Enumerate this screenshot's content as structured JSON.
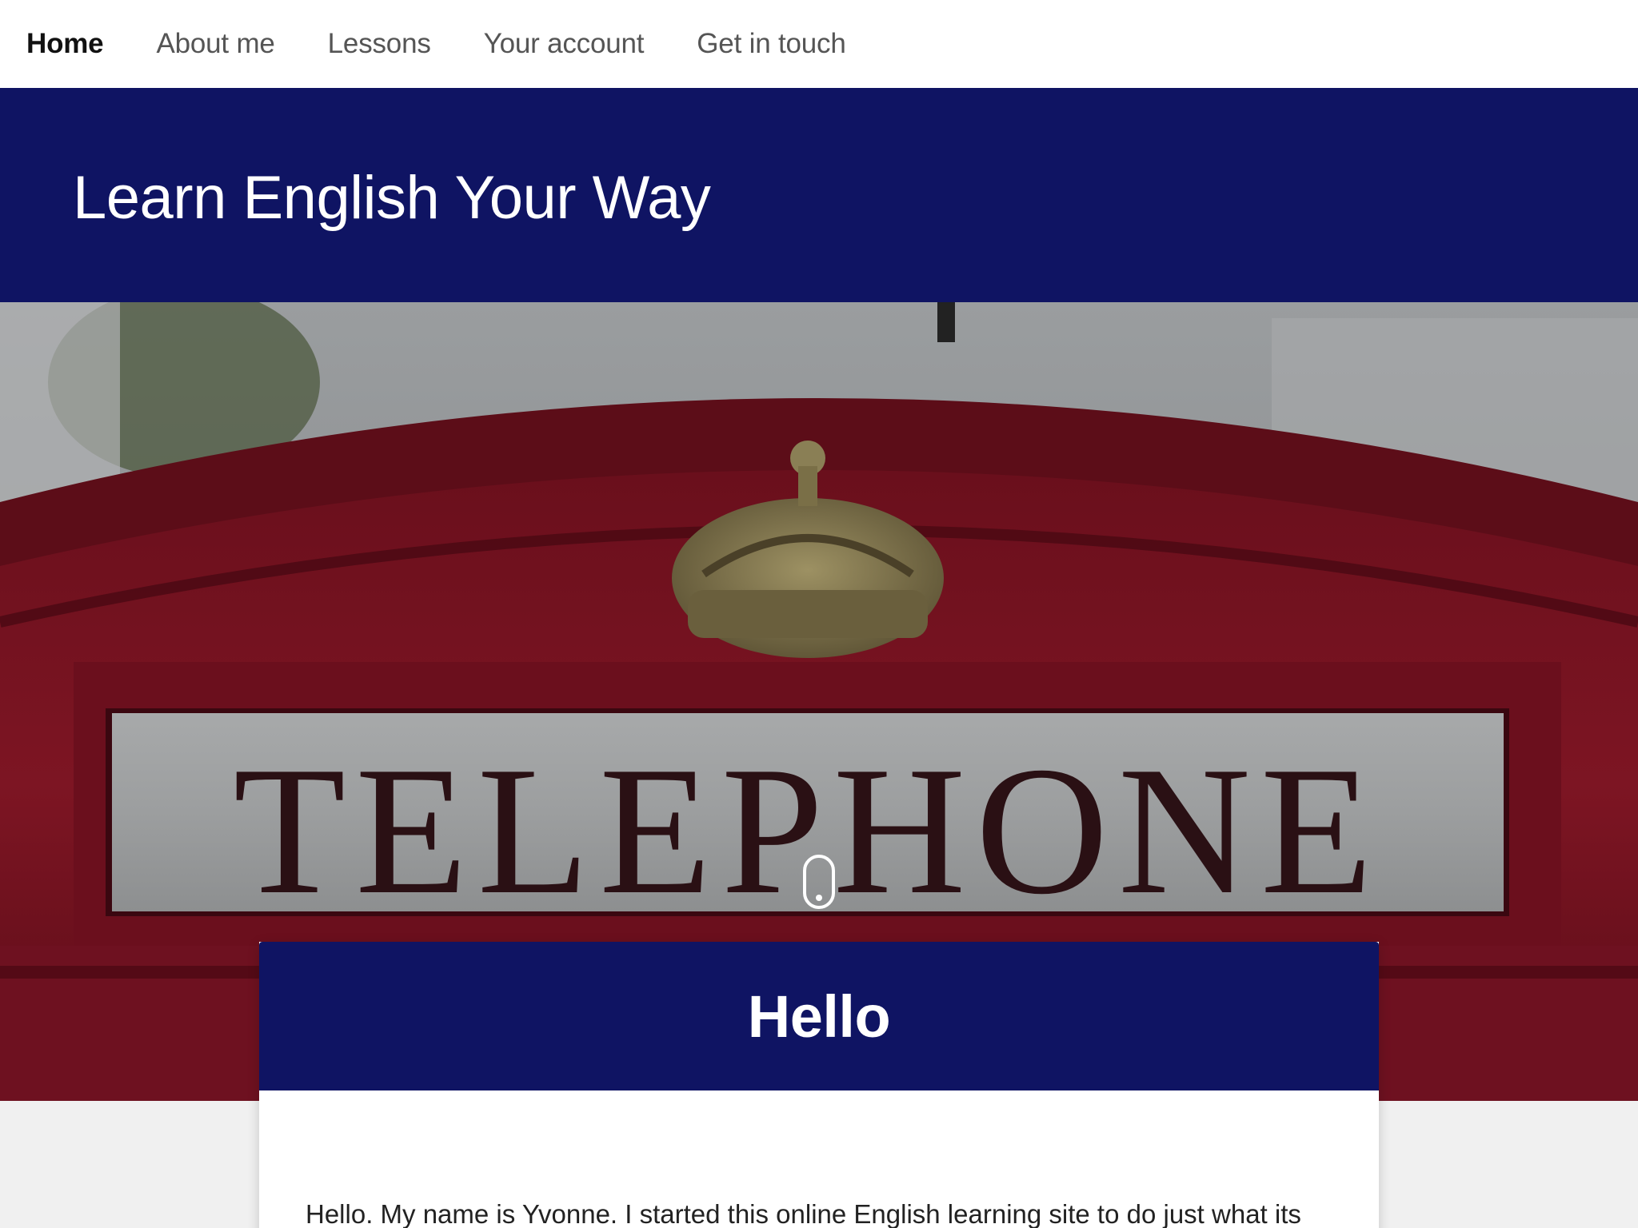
{
  "nav": {
    "items": [
      {
        "label": "Home",
        "active": true
      },
      {
        "label": "About me",
        "active": false
      },
      {
        "label": "Lessons",
        "active": false
      },
      {
        "label": "Your account",
        "active": false
      },
      {
        "label": "Get in touch",
        "active": false
      }
    ]
  },
  "banner": {
    "title": "Learn English Your Way"
  },
  "hero": {
    "sign_text": "TELEPHONE"
  },
  "card": {
    "heading": "Hello",
    "intro_text": "Hello. My name is Yvonne. I started this online English learning site to do just what its"
  },
  "colors": {
    "brand_navy": "#0f1463",
    "booth_red": "#7a1420",
    "page_background": "#f0f0f0"
  }
}
